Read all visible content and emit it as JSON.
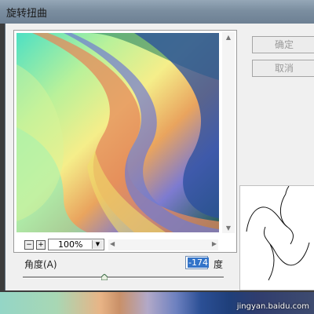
{
  "window": {
    "title": "旋转扭曲"
  },
  "buttons": {
    "ok": "确定",
    "cancel": "取消"
  },
  "preview": {
    "zoom": "100%",
    "zoom_out": "−",
    "zoom_in": "+"
  },
  "controls": {
    "angle_label": "角度(A)",
    "angle_value": "-174",
    "angle_unit": "度"
  },
  "slider": {
    "min": -999,
    "max": 999,
    "value": -174
  },
  "watermark": "jingyan.baidu.com",
  "colors": {
    "titlebar": "#7b8ea0",
    "dialog_bg": "#f0f0f0",
    "selection": "#3374c9"
  }
}
